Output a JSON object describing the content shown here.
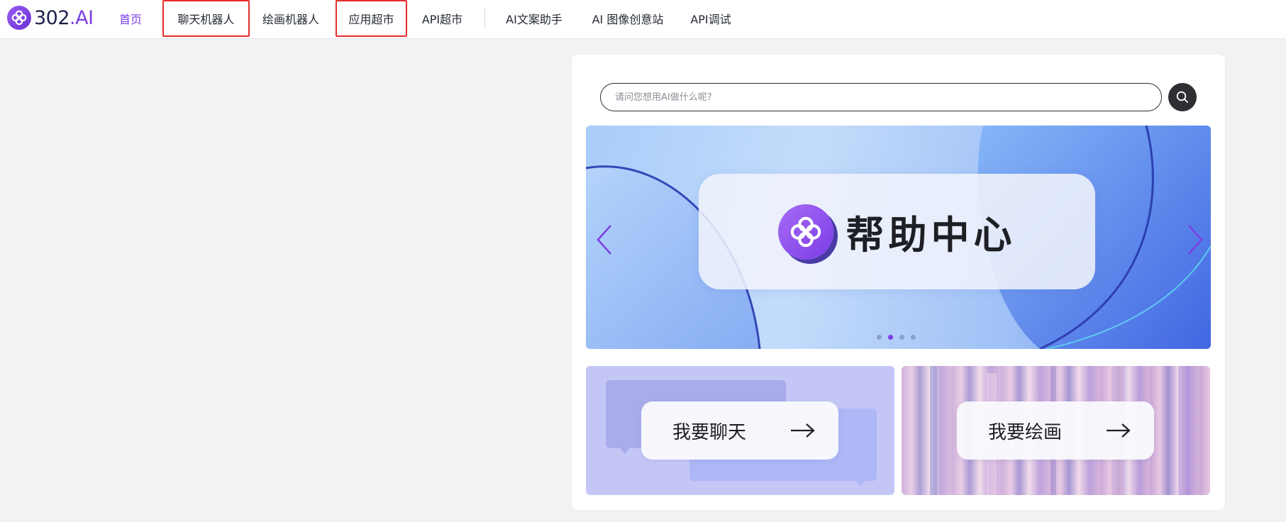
{
  "brand": {
    "name": "302",
    "suffix": ".AI"
  },
  "nav": {
    "home": "首页",
    "chatbot": "聊天机器人",
    "drawbot": "绘画机器人",
    "app_market": "应用超市",
    "api_market": "API超市",
    "copywriter": "AI文案助手",
    "image_site": "AI 图像创意站",
    "api_debug": "API调试"
  },
  "search": {
    "placeholder": "请问您想用AI做什么呢?"
  },
  "banner": {
    "title": "帮助中心",
    "slide_count": 4,
    "active_slide": 2
  },
  "tiles": {
    "chat": "我要聊天",
    "draw": "我要绘画"
  },
  "colors": {
    "accent": "#7b3fe4",
    "highlight_box": "#e52b2b",
    "search_button": "#2d2f33"
  },
  "icons": {
    "logo": "302ai-logo-icon",
    "search": "search-icon",
    "prev": "chevron-left-icon",
    "next": "chevron-right-icon",
    "tile_arrow": "arrow-right-icon"
  }
}
